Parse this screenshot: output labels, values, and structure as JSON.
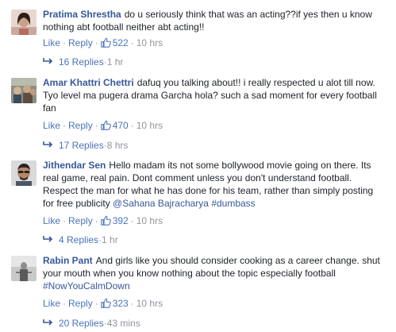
{
  "comments": [
    {
      "author": "Pratima Shrestha",
      "text": "do u seriously think that was an acting??if yes then u know nothing abt football neither abt acting!!",
      "like_label": "Like",
      "reply_label": "Reply",
      "likes": "522",
      "time": "10 hrs",
      "replies_label": "16 Replies",
      "replies_time": "1 hr"
    },
    {
      "author": "Amar Khattri Chettri",
      "text": "dafuq you talking about!! i really respected u alot till now. Tyo level ma pugera drama Garcha hola? such a sad moment for every football fan",
      "like_label": "Like",
      "reply_label": "Reply",
      "likes": "470",
      "time": "10 hrs",
      "replies_label": "17 Replies",
      "replies_time": "8 hrs"
    },
    {
      "author": "Jithendar Sen",
      "text": "Hello madam its not some bollywood movie going on there. Its real game, real pain. Dont comment unless you don't understand football. Respect the man for what he has done for his team, rather than simply posting for free publicity",
      "mention": "@Sahana Bajracharya",
      "hashtag": "#dumbass",
      "like_label": "Like",
      "reply_label": "Reply",
      "likes": "392",
      "time": "10 hrs",
      "replies_label": "4 Replies",
      "replies_time": "1 hr"
    },
    {
      "author": "Rabin Pant",
      "text": "And girls like you should consider cooking as a career change. shut your mouth when you know nothing about the topic especially football",
      "hashtag": "#NowYouCalmDown",
      "like_label": "Like",
      "reply_label": "Reply",
      "likes": "323",
      "time": "10 hrs",
      "replies_label": "20 Replies",
      "replies_time": "43 mins"
    }
  ],
  "separator": "·",
  "colors": {
    "link": "#365899",
    "meta": "#90949c",
    "text": "#1d2129",
    "action": "#4b73b8"
  },
  "icons": {
    "like": "thumbs-up-icon",
    "reply_thread": "reply-arrow-icon"
  }
}
